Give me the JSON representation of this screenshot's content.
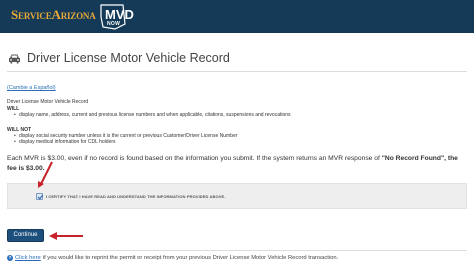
{
  "header": {
    "logo_text": "ServiceArizona",
    "mvd_logo_text": "MVD",
    "mvd_now_text": "NOW"
  },
  "page": {
    "title": "Driver License Motor Vehicle Record",
    "icon": "car-icon",
    "language_link": "(Cambie a Español)"
  },
  "content": {
    "intro": "Driver License Motor Vehicle Record",
    "will_heading": "WILL",
    "will_items": [
      "display name, address, current and previous license numbers and when applicable, citations, suspensions and revocations"
    ],
    "will_not_heading": "WILL NOT",
    "will_not_items": [
      "display social security number unless it is the current or previous Customer/Driver License Number",
      "display medical information for CDL holders"
    ],
    "fee_text": "Each MVR is $3.00, even if no record is found based on the information you submit. If the system returns an MVR response of ",
    "fee_bold_1": "\"No Record Found\", the fee is $3.00",
    "fee_end": "."
  },
  "certify": {
    "checked": true,
    "label": "I CERTIFY THAT I HAVE READ AND UNDERSTAND THE INFORMATION PROVIDED ABOVE."
  },
  "actions": {
    "continue_label": "Continue"
  },
  "footer": {
    "help_icon": "question-circle-icon",
    "reprint_link": "Click here",
    "reprint_text": "if you would like to reprint the permit or receipt from your previous Driver License Motor Vehicle Record transaction."
  },
  "colors": {
    "header_bg": "#143a57",
    "logo_gold": "#e8a83a",
    "link_blue": "#2a6ebb",
    "button_blue": "#1d4f7c",
    "annotation_arrow": "#c8232c"
  }
}
